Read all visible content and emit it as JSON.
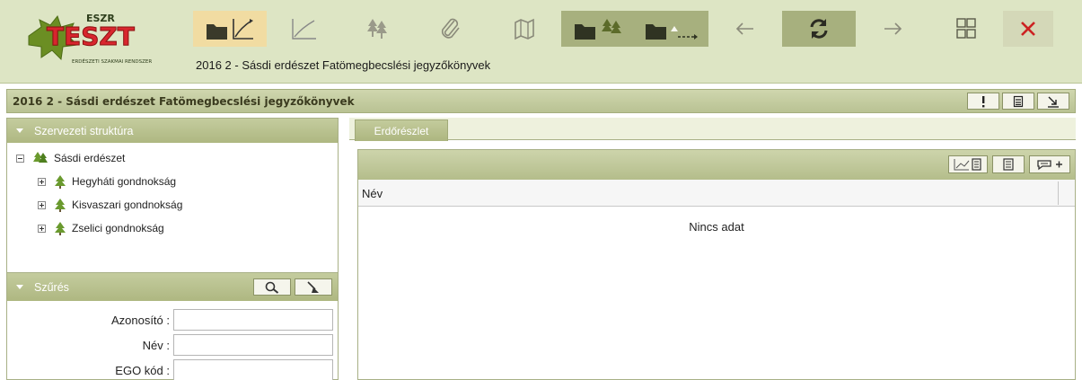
{
  "app": {
    "logo_text": "TESZT",
    "logo_subtitle": "ERDÉSZETI SZAKMAI RENDSZER",
    "page_title": "2016 2 - Sásdi erdészet Fatömegbecslési jegyzőkönyvek"
  },
  "toolbar": {
    "icons": [
      "folder-chart-icon",
      "line-chart-icon",
      "trees-icon",
      "paperclip-icon",
      "map-icon",
      "folder-trees-icon",
      "folder-trees-arrow-icon",
      "back-arrow-icon",
      "refresh-icon",
      "forward-arrow-icon",
      "grid-view-icon",
      "close-icon"
    ],
    "colors": {
      "background": "#dde5c4",
      "active": "#f1dca2",
      "dark": "#a7b07e",
      "close": "#cc2222"
    }
  },
  "titlebar": {
    "text": "2016 2 - Sásdi erdészet Fatömegbecslési jegyzőkönyvek",
    "buttons": [
      "alert-icon",
      "form-icon",
      "collapse-arrow-icon"
    ]
  },
  "structure": {
    "header": "Szervezeti struktúra",
    "root": {
      "label": "Sásdi erdészet",
      "expanded": true
    },
    "children": [
      {
        "label": "Hegyháti gondnokság"
      },
      {
        "label": "Kisvaszari gondnokság"
      },
      {
        "label": "Zselici gondnokság"
      }
    ]
  },
  "filter": {
    "header": "Szűrés",
    "fields": [
      {
        "label": "Azonosító :",
        "value": ""
      },
      {
        "label": "Név :",
        "value": ""
      },
      {
        "label": "EGO kód :",
        "value": ""
      }
    ]
  },
  "main": {
    "tabs": [
      {
        "label": "Erdőrészlet",
        "active": true
      }
    ],
    "grid": {
      "columns": [
        "Név"
      ],
      "empty_text": "Nincs adat",
      "toolbar_icons": [
        "chart-calculator-icon",
        "calculator-icon",
        "comment-add-icon"
      ]
    }
  }
}
